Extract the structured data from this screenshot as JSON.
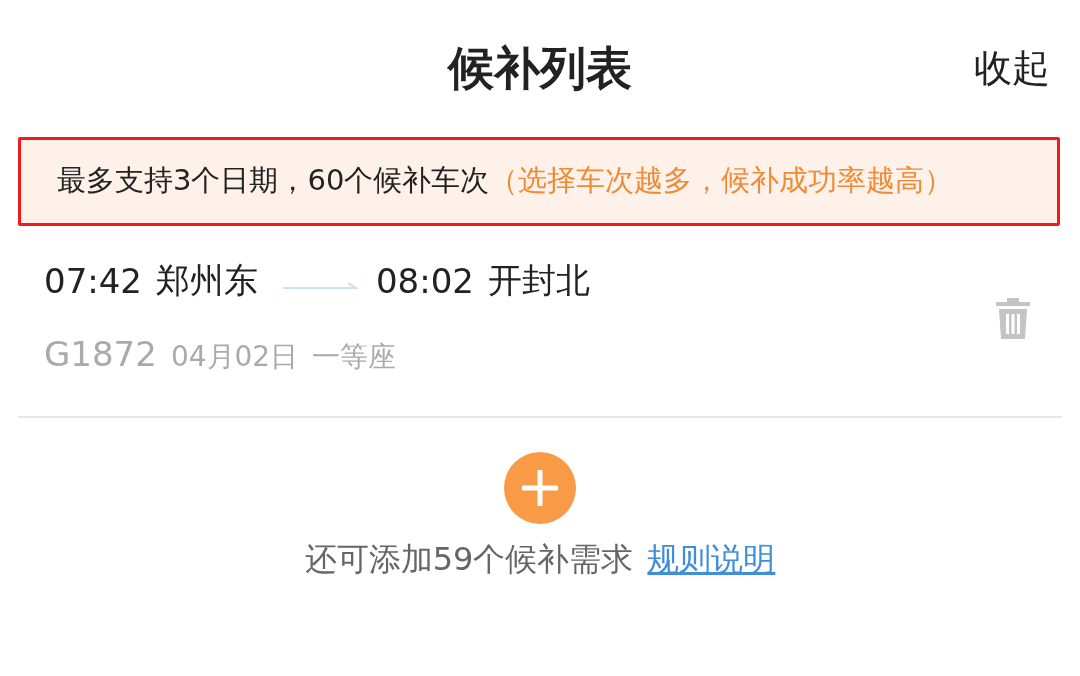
{
  "header": {
    "title": "候补列表",
    "collapse": "收起"
  },
  "notice": {
    "text": "最多支持3个日期，60个候补车次",
    "hint": "（选择车次越多，候补成功率越高）",
    "highlighted": true
  },
  "trips": [
    {
      "depart_time": "07:42",
      "depart_station": "郑州东",
      "arrive_time": "08:02",
      "arrive_station": "开封北",
      "train": "G1872",
      "date": "04月02日",
      "seat": "一等座"
    }
  ],
  "footer": {
    "remaining": "还可添加59个候补需求",
    "rules_link": "规则说明"
  }
}
